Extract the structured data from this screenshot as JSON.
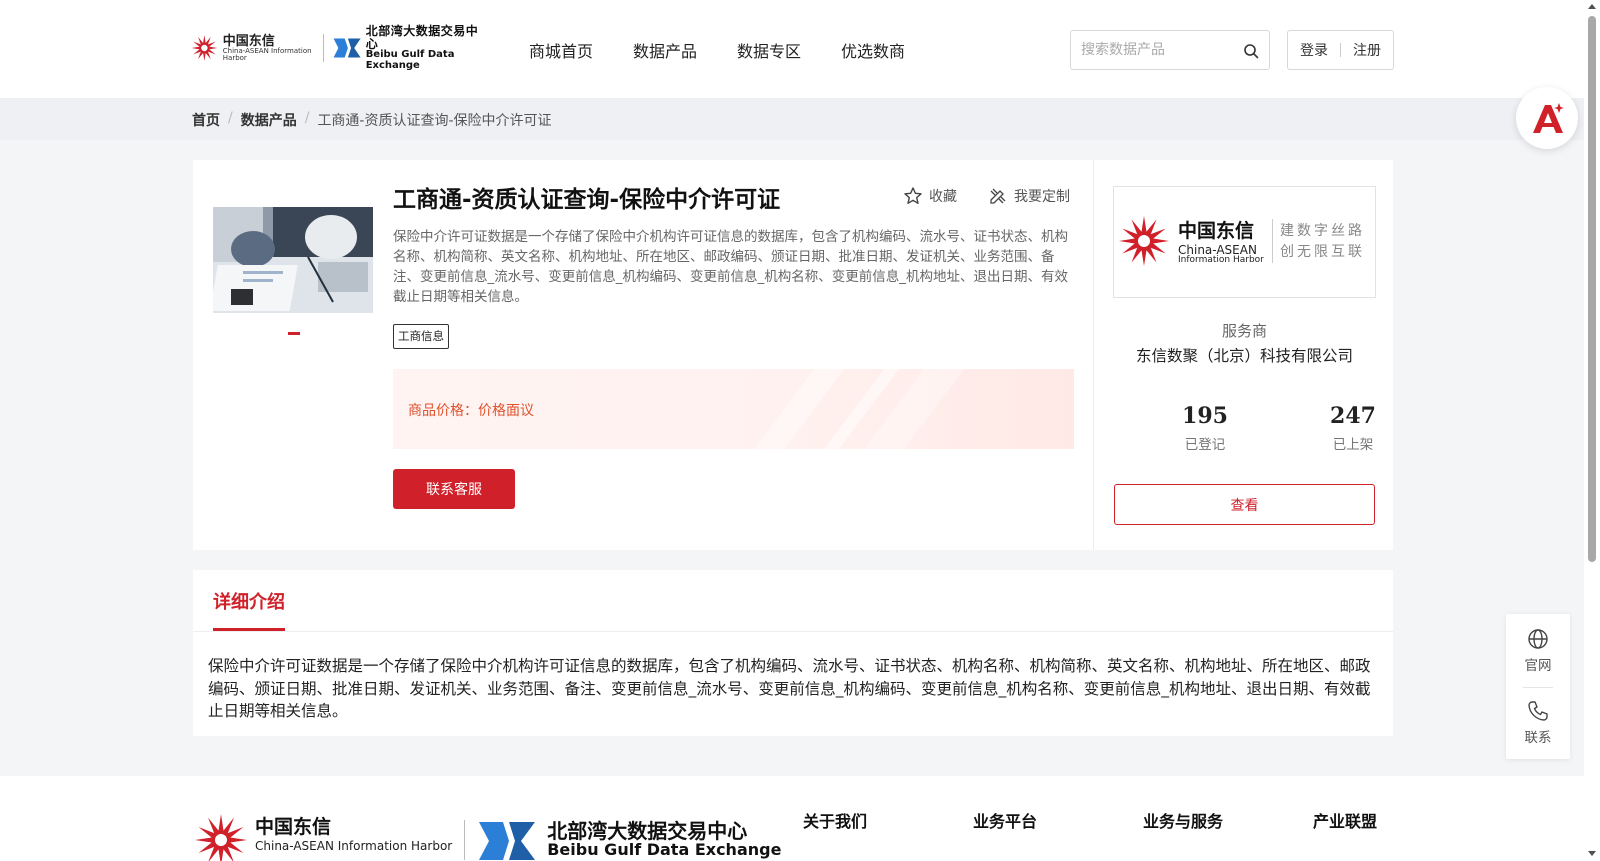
{
  "header": {
    "logo_ct_cn": "中国东信",
    "logo_ct_en": "China-ASEAN Information Harbor",
    "logo_bg_cn": "北部湾大数据交易中心",
    "logo_bg_en": "Beibu Gulf Data Exchange",
    "nav": [
      "商城首页",
      "数据产品",
      "数据专区",
      "优选数商"
    ],
    "search_placeholder": "搜索数据产品",
    "login": "登录",
    "register": "注册"
  },
  "breadcrumb": {
    "home": "首页",
    "products": "数据产品",
    "current": "工商通-资质认证查询-保险中介许可证",
    "sep": "/"
  },
  "product": {
    "title": "工商通-资质认证查询-保险中介许可证",
    "favorite": "收藏",
    "customize": "我要定制",
    "description": "保险中介许可证数据是一个存储了保险中介机构许可证信息的数据库，包含了机构编码、流水号、证书状态、机构名称、机构简称、英文名称、机构地址、所在地区、邮政编码、颁证日期、批准日期、发证机关、业务范围、备注、变更前信息_流水号、变更前信息_机构编码、变更前信息_机构名称、变更前信息_机构地址、退出日期、有效截止日期等相关信息。",
    "tag": "工商信息",
    "price_label": "商品价格：",
    "price_value": "价格面议",
    "contact_button": "联系客服"
  },
  "vendor": {
    "logo_cn": "中国东信",
    "logo_en1": "China-ASEAN",
    "logo_en2": "Information Harbor",
    "slogan_line1": "建数字丝路",
    "slogan_line2": "创无限互联",
    "type": "服务商",
    "name": "东信数聚（北京）科技有限公司",
    "registered_count": "195",
    "registered_label": "已登记",
    "listed_count": "247",
    "listed_label": "已上架",
    "view_button": "查看"
  },
  "detail": {
    "tab": "详细介绍",
    "text": "保险中介许可证数据是一个存储了保险中介机构许可证信息的数据库，包含了机构编码、流水号、证书状态、机构名称、机构简称、英文名称、机构地址、所在地区、邮政编码、颁证日期、批准日期、发证机关、业务范围、备注、变更前信息_流水号、变更前信息_机构编码、变更前信息_机构名称、变更前信息_机构地址、退出日期、有效截止日期等相关信息。"
  },
  "side_widget": {
    "website": "官网",
    "contact": "联系"
  },
  "footer": {
    "logo_ct_cn": "中国东信",
    "logo_ct_en": "China-ASEAN Information Harbor",
    "logo_bg_cn": "北部湾大数据交易中心",
    "logo_bg_en": "Beibu Gulf Data Exchange",
    "links": [
      "关于我们",
      "业务平台",
      "业务与服务",
      "产业联盟"
    ]
  },
  "colors": {
    "brand_red": "#d0202a",
    "price_orange": "#e0512d"
  }
}
